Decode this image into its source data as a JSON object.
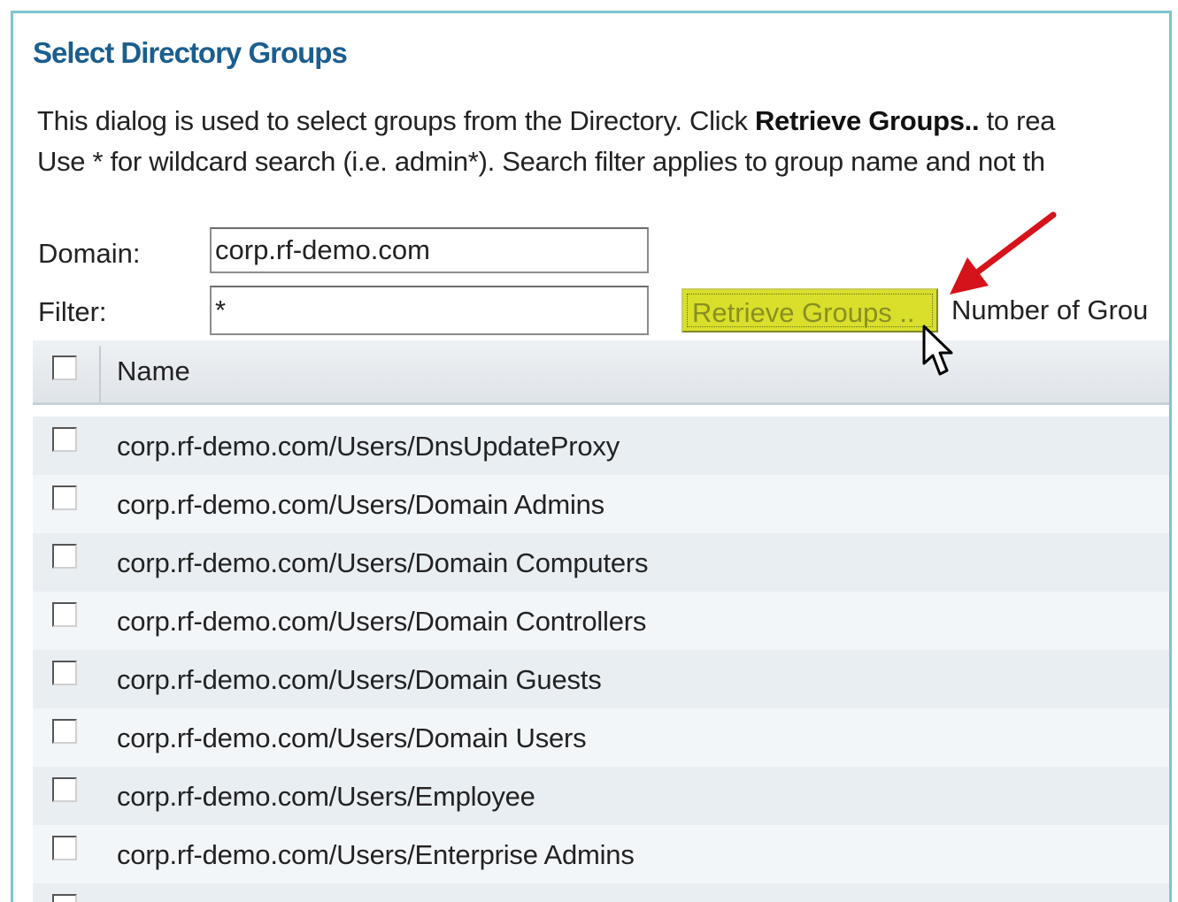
{
  "dialog": {
    "title": "Select Directory Groups",
    "description_line1_pre": "This dialog is used to select groups from the Directory. Click ",
    "description_line1_bold": "Retrieve Groups..",
    "description_line1_post": " to rea",
    "description_line2": "Use * for wildcard search (i.e. admin*). Search filter applies to group name and not th"
  },
  "form": {
    "domain_label": "Domain:",
    "domain_value": "corp.rf-demo.com",
    "filter_label": "Filter:",
    "filter_value": "*",
    "retrieve_button_label": "Retrieve Groups ..",
    "number_of_groups_label": "Number of Grou"
  },
  "table": {
    "header_name": "Name",
    "rows": [
      "corp.rf-demo.com/Users/DnsUpdateProxy",
      "corp.rf-demo.com/Users/Domain Admins",
      "corp.rf-demo.com/Users/Domain Computers",
      "corp.rf-demo.com/Users/Domain Controllers",
      "corp.rf-demo.com/Users/Domain Guests",
      "corp.rf-demo.com/Users/Domain Users",
      "corp.rf-demo.com/Users/Employee",
      "corp.rf-demo.com/Users/Enterprise Admins"
    ]
  },
  "colors": {
    "title": "#1b5e8f",
    "button_bg": "#d9df2a",
    "arrow": "#d4141a",
    "frame": "#7cc6cf"
  },
  "icons": [
    "red-arrow-annotation-icon",
    "mouse-cursor-icon",
    "checkbox-icon"
  ]
}
